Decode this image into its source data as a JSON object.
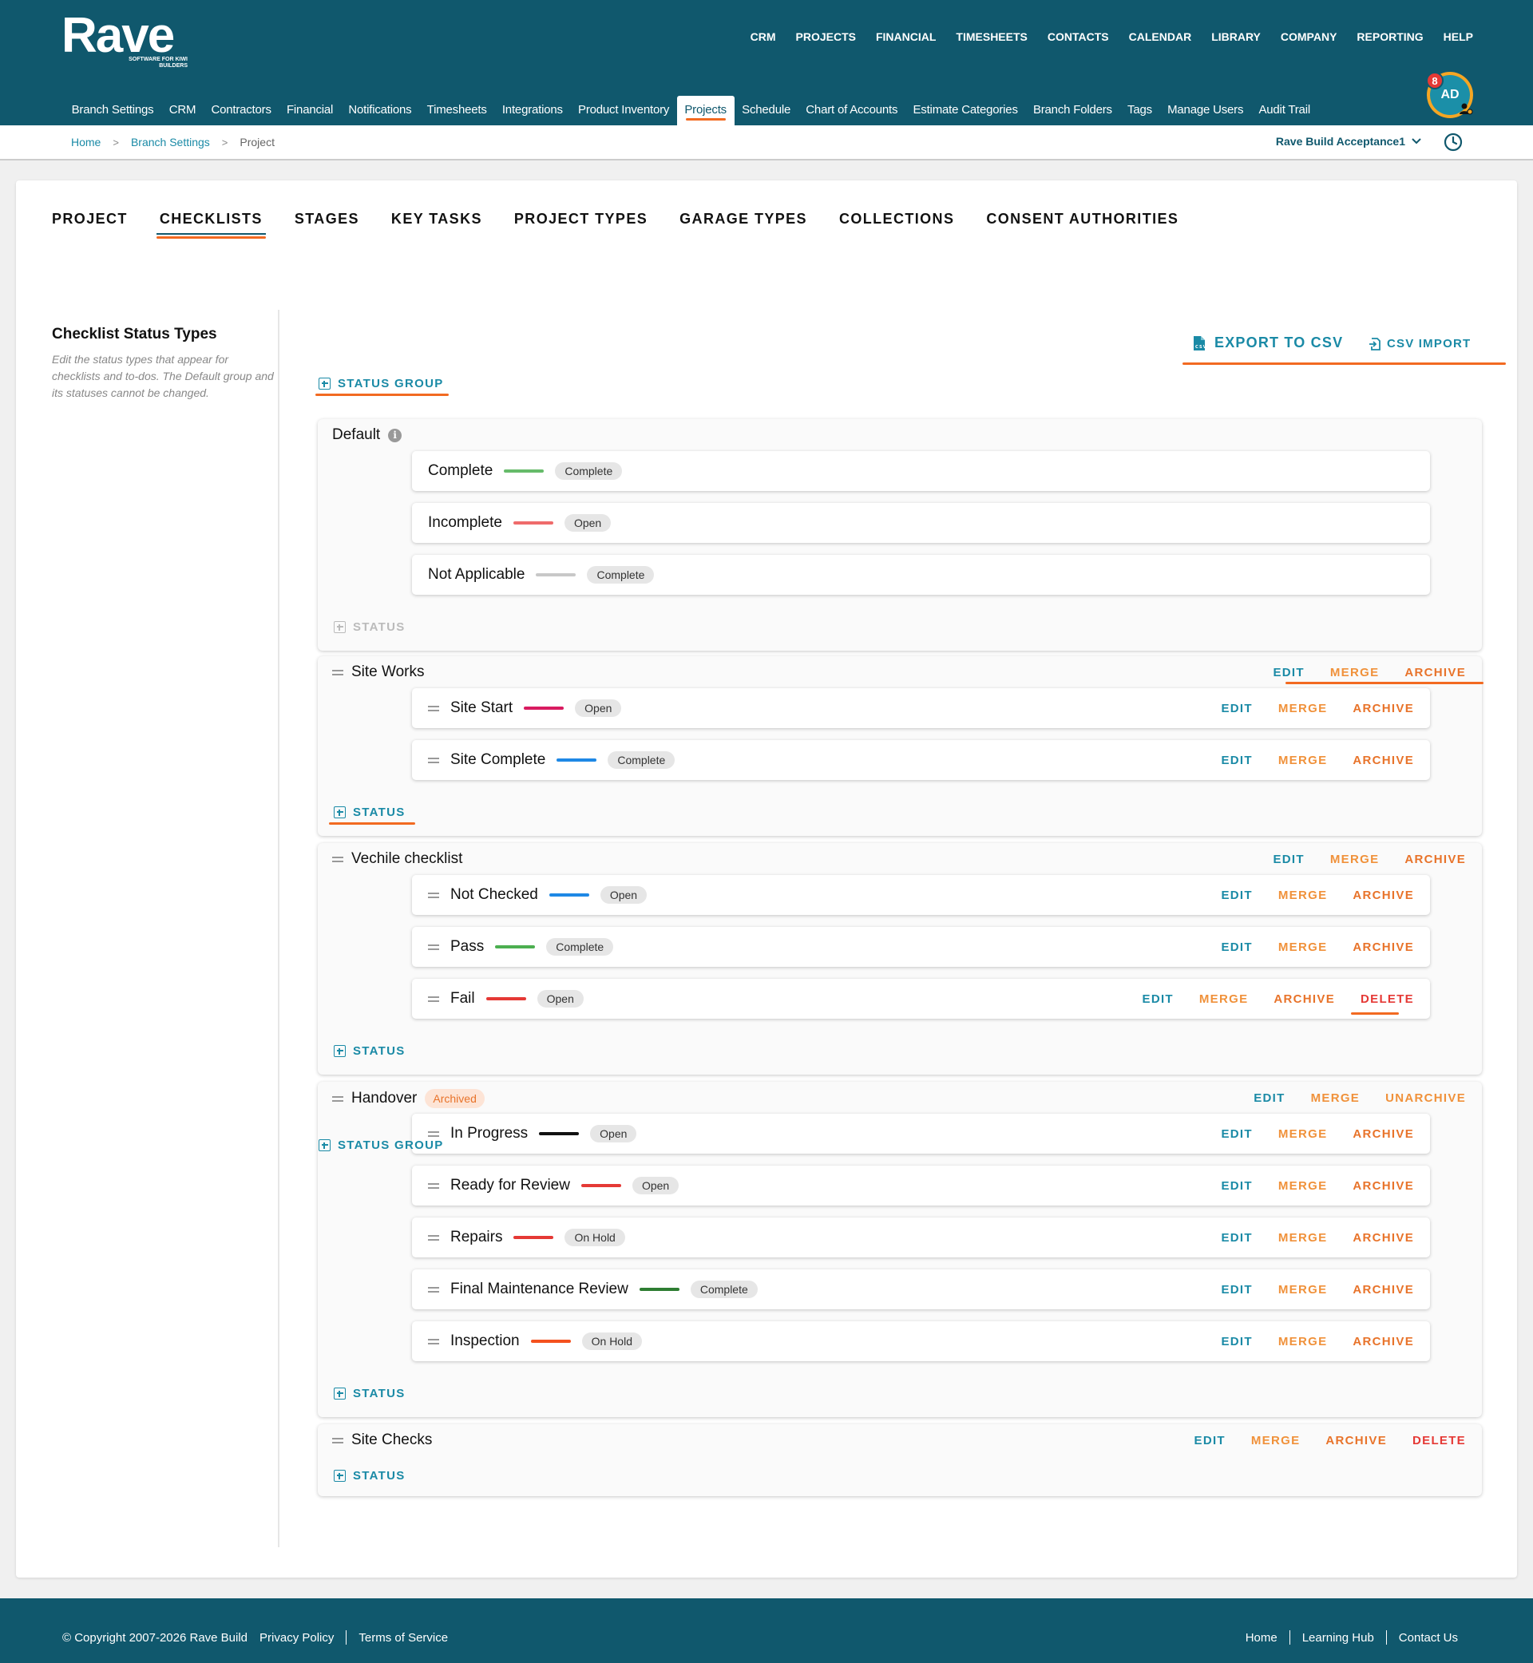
{
  "brand": {
    "name": "Rave",
    "tagline": "SOFTWARE FOR KIWI BUILDERS"
  },
  "main_nav": [
    "CRM",
    "PROJECTS",
    "FINANCIAL",
    "TIMESHEETS",
    "CONTACTS",
    "CALENDAR",
    "LIBRARY",
    "COMPANY",
    "REPORTING",
    "HELP"
  ],
  "sub_nav": [
    "Branch Settings",
    "CRM",
    "Contractors",
    "Financial",
    "Notifications",
    "Timesheets",
    "Integrations",
    "Product Inventory",
    "Projects",
    "Schedule",
    "Chart of Accounts",
    "Estimate Categories",
    "Branch Folders",
    "Tags",
    "Manage Users",
    "Audit Trail"
  ],
  "sub_nav_active": "Projects",
  "user": {
    "initials": "AD",
    "notification_count": "8"
  },
  "breadcrumb": [
    "Home",
    "Branch Settings",
    "Project"
  ],
  "branch_selector": "Rave Build Acceptance1",
  "tabs": [
    "PROJECT",
    "CHECKLISTS",
    "STAGES",
    "KEY TASKS",
    "PROJECT TYPES",
    "GARAGE TYPES",
    "COLLECTIONS",
    "CONSENT AUTHORITIES"
  ],
  "tab_active": "CHECKLISTS",
  "section": {
    "title": "Checklist Status Types",
    "description": "Edit the status types that appear for checklists and to-dos. The Default group and its statuses cannot be changed."
  },
  "buttons": {
    "export": "EXPORT TO CSV",
    "import": "CSV IMPORT",
    "add_group": "STATUS GROUP",
    "add_status": "STATUS"
  },
  "action_labels": {
    "edit": "EDIT",
    "merge": "MERGE",
    "archive": "ARCHIVE",
    "unarchive": "UNARCHIVE",
    "delete": "DELETE"
  },
  "archived_label": "Archived",
  "colors": {
    "header": "#10586d",
    "accent": "#1a8aa6",
    "annotation": "#f26a21"
  },
  "groups": [
    {
      "name": "Default",
      "default": true,
      "statuses": [
        {
          "name": "Complete",
          "color": "#66bb6a",
          "type": "Complete"
        },
        {
          "name": "Incomplete",
          "color": "#ef6b6b",
          "type": "Open"
        },
        {
          "name": "Not Applicable",
          "color": "#c8c8c8",
          "type": "Complete"
        }
      ]
    },
    {
      "name": "Site Works",
      "group_actions": [
        "edit",
        "merge",
        "archive"
      ],
      "statuses": [
        {
          "name": "Site Start",
          "color": "#d81b60",
          "type": "Open",
          "actions": [
            "edit",
            "merge",
            "archive"
          ]
        },
        {
          "name": "Site Complete",
          "color": "#1e88e5",
          "type": "Complete",
          "actions": [
            "edit",
            "merge",
            "archive"
          ]
        }
      ]
    },
    {
      "name": "Vechile checklist",
      "group_actions": [
        "edit",
        "merge",
        "archive"
      ],
      "statuses": [
        {
          "name": "Not Checked",
          "color": "#1e88e5",
          "type": "Open",
          "actions": [
            "edit",
            "merge",
            "archive"
          ]
        },
        {
          "name": "Pass",
          "color": "#4caf50",
          "type": "Complete",
          "actions": [
            "edit",
            "merge",
            "archive"
          ]
        },
        {
          "name": "Fail",
          "color": "#e53935",
          "type": "Open",
          "actions": [
            "edit",
            "merge",
            "archive",
            "delete"
          ]
        }
      ]
    },
    {
      "name": "Handover",
      "archived": true,
      "group_actions": [
        "edit",
        "merge",
        "unarchive"
      ],
      "statuses": [
        {
          "name": "In Progress",
          "color": "#111111",
          "type": "Open",
          "actions": [
            "edit",
            "merge",
            "archive"
          ]
        },
        {
          "name": "Ready for Review",
          "color": "#e53935",
          "type": "Open",
          "actions": [
            "edit",
            "merge",
            "archive"
          ]
        },
        {
          "name": "Repairs",
          "color": "#e53935",
          "type": "On Hold",
          "actions": [
            "edit",
            "merge",
            "archive"
          ]
        },
        {
          "name": "Final Maintenance Review",
          "color": "#2e7d32",
          "type": "Complete",
          "actions": [
            "edit",
            "merge",
            "archive"
          ]
        },
        {
          "name": "Inspection",
          "color": "#f4511e",
          "type": "On Hold",
          "actions": [
            "edit",
            "merge",
            "archive"
          ]
        }
      ]
    },
    {
      "name": "Site Checks",
      "group_actions": [
        "edit",
        "merge",
        "archive",
        "delete"
      ],
      "statuses": []
    }
  ],
  "footer": {
    "copyright": "© Copyright 2007-2026 Rave Build",
    "left_links": [
      "Privacy Policy",
      "Terms of Service"
    ],
    "right_links": [
      "Home",
      "Learning Hub",
      "Contact Us"
    ]
  }
}
